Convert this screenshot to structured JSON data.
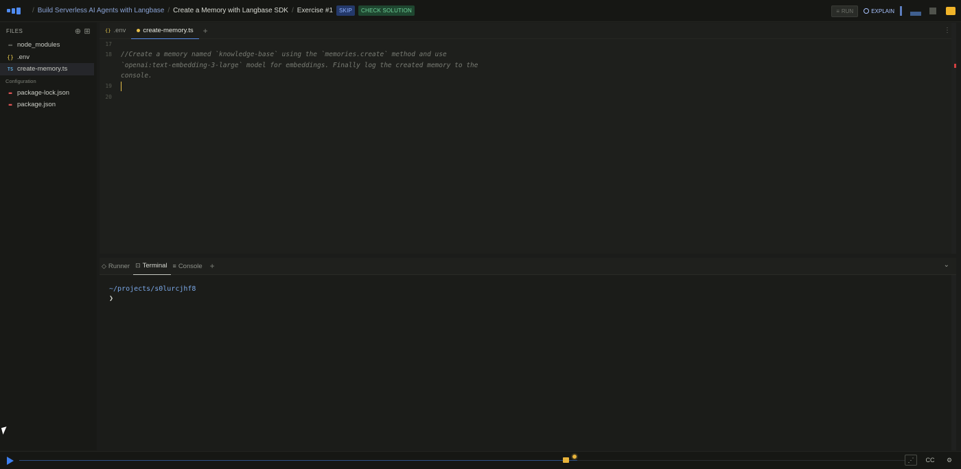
{
  "topbar": {
    "breadcrumbs": [
      "Build Serverless AI Agents with Langbase",
      "Create a Memory with Langbase SDK",
      "Exercise #1"
    ],
    "skip_label": "SKIP",
    "check_label": "CHECK SOLUTION",
    "run_label": "RUN",
    "explain_label": "EXPLAIN"
  },
  "sidebar": {
    "title": "FILES",
    "items": [
      {
        "label": "node_modules",
        "icon": "folder-icon"
      },
      {
        "label": ".env",
        "icon": "env-icon"
      },
      {
        "label": "create-memory.ts",
        "icon": "ts-icon"
      }
    ],
    "section_label": "Configuration",
    "config_items": [
      {
        "label": "package-lock.json",
        "icon": "json-icon"
      },
      {
        "label": "package.json",
        "icon": "json-icon"
      }
    ]
  },
  "editor": {
    "tabs": [
      {
        "label": ".env"
      },
      {
        "label": "create-memory.ts"
      }
    ],
    "line_numbers": [
      "17",
      "18",
      "19",
      "20"
    ],
    "lines": [
      "",
      "//Create a memory named `knowledge-base` using the `memories.create` method and use",
      "`openai:text-embedding-3-large` model for embeddings. Finally log the created memory to the",
      "console."
    ]
  },
  "panel": {
    "tabs": [
      "Runner",
      "Terminal",
      "Console"
    ],
    "terminal_path": "~/projects/s0lurcjhf8",
    "prompt": "❯"
  },
  "player": {
    "progress": 0.63,
    "cc_label": "CC"
  },
  "colors": {
    "accent": "#4f8bf0",
    "skip_badge": "#24396a",
    "check_badge": "#1f4730",
    "cursor": "#e8c04a"
  }
}
